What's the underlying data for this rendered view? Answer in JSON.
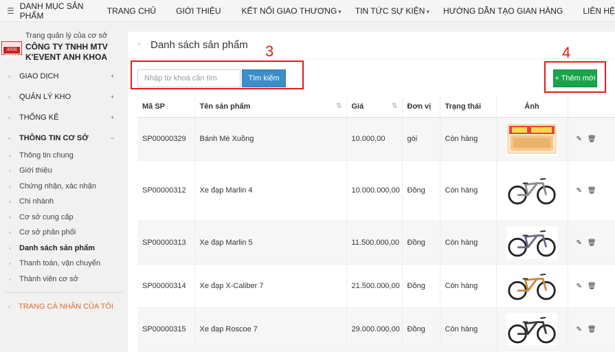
{
  "topnav": {
    "category_menu": "DANH MỤC SẢN PHẨM",
    "items": [
      {
        "label": "TRANG CHỦ",
        "dropdown": false
      },
      {
        "label": "GIỚI THIỆU",
        "dropdown": false
      },
      {
        "label": "KẾT NỐI GIAO THƯƠNG",
        "dropdown": true
      },
      {
        "label": "TIN TỨC SỰ KIỆN",
        "dropdown": true
      },
      {
        "label": "HƯỚNG DẪN TẠO GIAN HÀNG",
        "dropdown": false
      },
      {
        "label": "LIÊN HỆ",
        "dropdown": false
      }
    ]
  },
  "sidebar": {
    "subtitle": "Trang quản lý của cơ sở",
    "company": "CÔNG TY TNHH MTV K'EVENT ANH KHOA",
    "logo_text": "ANH KHOA",
    "groups": [
      {
        "label": "GIAO DỊCH",
        "toggle": "+"
      },
      {
        "label": "QUẢN LÝ KHO",
        "toggle": "+"
      },
      {
        "label": "THỐNG KÊ",
        "toggle": "+"
      },
      {
        "label": "THÔNG TIN CƠ SỞ",
        "toggle": "−"
      }
    ],
    "sub_items": [
      "Thông tin chung",
      "Giới thiệu",
      "Chứng nhận, xác nhận",
      "Chi nhánh",
      "Cơ sở cung cấp",
      "Cơ sở phân phối",
      "Danh sách sản phẩm",
      "Thanh toán, vận chuyển",
      "Thành viên cơ sở"
    ],
    "current_sub_item": "Danh sách sản phẩm",
    "personal": "TRANG CÁ NHÂN CỦA TÔI"
  },
  "main": {
    "title": "Danh sách sản phẩm",
    "marker_search": "3",
    "marker_add": "4",
    "search": {
      "placeholder": "Nhập từ khoá cần tìm",
      "value": "",
      "button": "Tìm kiếm"
    },
    "add_button": "Thêm mới",
    "columns": [
      "Mã SP",
      "Tên sản phẩm",
      "Giá",
      "Đơn vị",
      "Trạng thái",
      "Ảnh",
      ""
    ],
    "rows": [
      {
        "code": "SP00000329",
        "name": "Bánh Mè Xuồng",
        "price": "10.000,00",
        "unit": "gói",
        "status": "Còn hàng",
        "image": "bread-pack"
      },
      {
        "code": "SP00000312",
        "name": "Xe đạp Marlin 4",
        "price": "10.000.000,00",
        "unit": "Đồng",
        "status": "Còn hàng",
        "image": "bike-grey"
      },
      {
        "code": "SP00000313",
        "name": "Xe đạp Marlin 5",
        "price": "11.500.000,00",
        "unit": "Đồng",
        "status": "Còn hàng",
        "image": "bike-purple"
      },
      {
        "code": "SP00000314",
        "name": "Xe đạp X-Caliber 7",
        "price": "21.500.000,00",
        "unit": "Đồng",
        "status": "Còn hàng",
        "image": "bike-orange"
      },
      {
        "code": "SP00000315",
        "name": "Xe đạp Roscoe 7",
        "price": "29.000.000,00",
        "unit": "Đồng",
        "status": "Còn hàng",
        "image": "bike-black"
      }
    ]
  },
  "colors": {
    "accent_orange": "#e2682f",
    "search_blue": "#3b8ec9",
    "add_green": "#18a54a",
    "annotation_red": "#e41a1a"
  }
}
